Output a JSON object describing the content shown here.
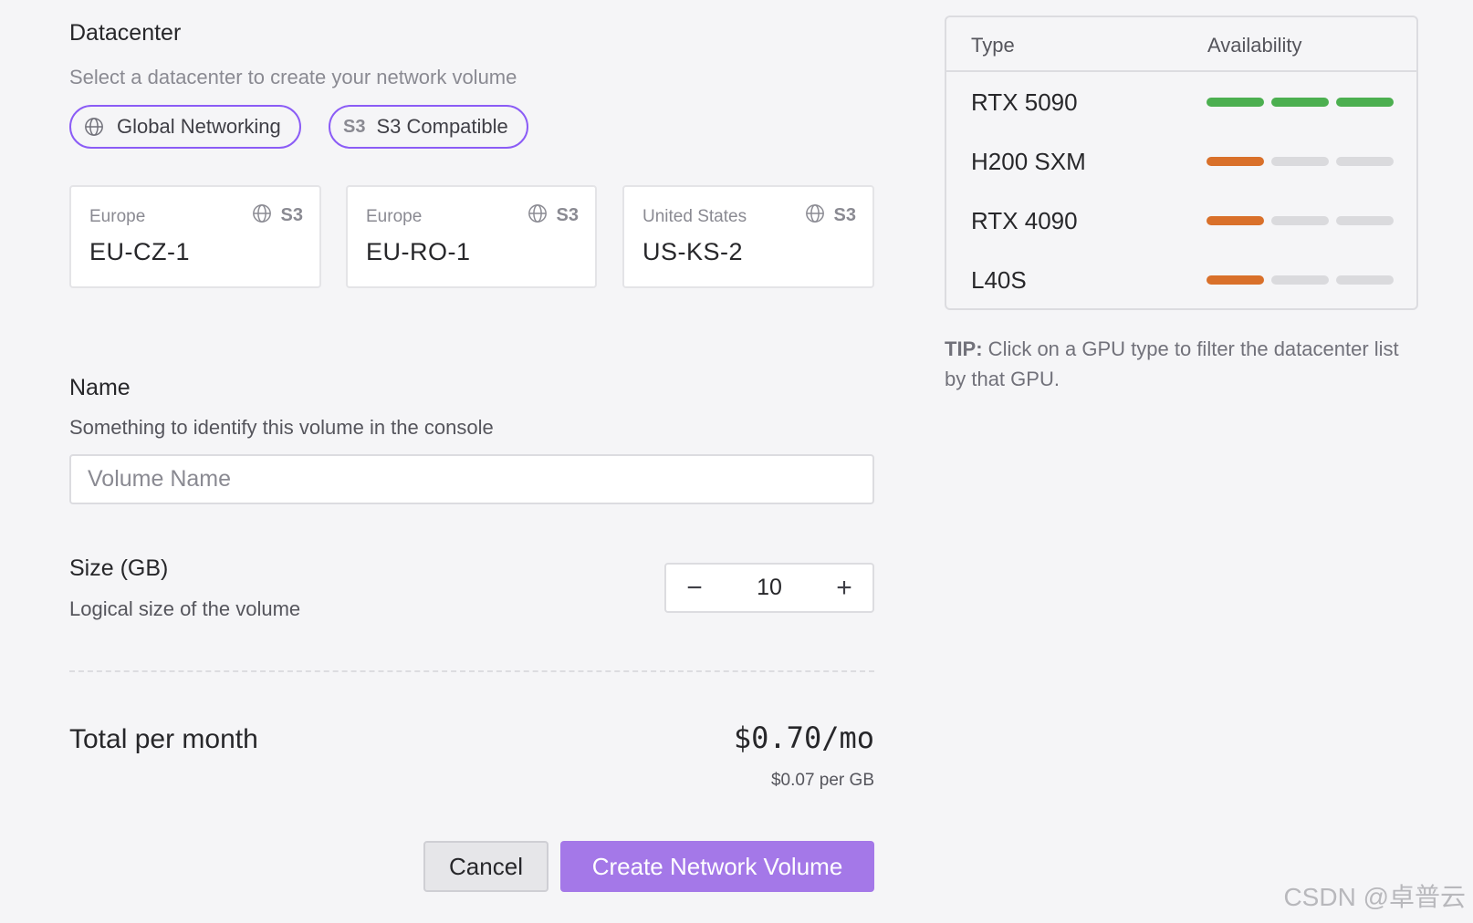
{
  "datacenter": {
    "title": "Datacenter",
    "subtitle": "Select a datacenter to create your network volume",
    "filters": [
      {
        "label": "Global Networking",
        "icon": "globe-icon"
      },
      {
        "label": "S3 Compatible",
        "icon_text": "S3"
      }
    ],
    "cards": [
      {
        "region": "Europe",
        "code": "EU-CZ-1",
        "badge": "S3"
      },
      {
        "region": "Europe",
        "code": "EU-RO-1",
        "badge": "S3"
      },
      {
        "region": "United States",
        "code": "US-KS-2",
        "badge": "S3"
      }
    ]
  },
  "name": {
    "title": "Name",
    "subtitle": "Something to identify this volume in the console",
    "placeholder": "Volume Name"
  },
  "size": {
    "title": "Size (GB)",
    "subtitle": "Logical size of the volume",
    "value": "10",
    "minus": "−",
    "plus": "+"
  },
  "total": {
    "label": "Total per month",
    "value": "$0.70/mo",
    "per_gb": "$0.07 per GB"
  },
  "actions": {
    "cancel": "Cancel",
    "create": "Create Network Volume"
  },
  "gpu_table": {
    "headers": {
      "type": "Type",
      "availability": "Availability"
    },
    "rows": [
      {
        "name": "RTX 5090",
        "availability_level": 3,
        "color": "#4caf50"
      },
      {
        "name": "H200 SXM",
        "availability_level": 1,
        "color": "#d9702a"
      },
      {
        "name": "RTX 4090",
        "availability_level": 1,
        "color": "#d9702a"
      },
      {
        "name": "L40S",
        "availability_level": 1,
        "color": "#d9702a"
      }
    ],
    "empty_color": "#dadadd"
  },
  "tip": {
    "label": "TIP:",
    "text": " Click on a GPU type to filter the datacenter list by that GPU."
  },
  "colors": {
    "accent": "#8b5cf6",
    "primary_button": "#a478e8"
  },
  "watermark": "CSDN @卓普云"
}
